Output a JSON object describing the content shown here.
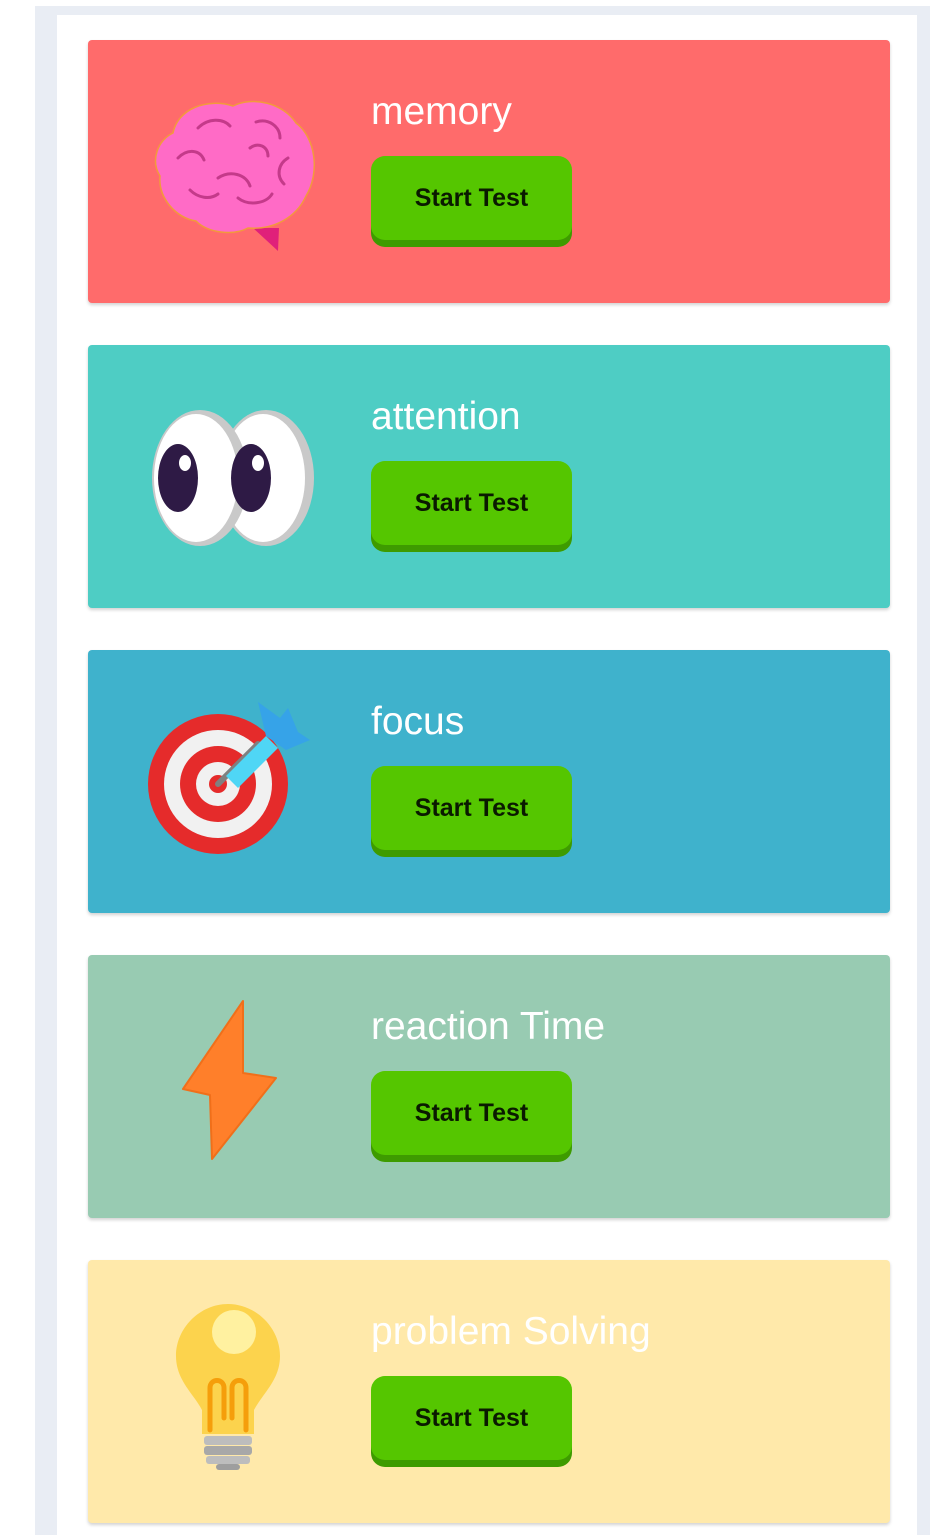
{
  "colors": {
    "memory_card": "#ff6b6b",
    "attention_card": "#4ecdc4",
    "focus_card": "#3fb2cc",
    "reaction_card": "#98cbb2",
    "problem_card": "#ffe9aa",
    "button": "#55c600",
    "button_shadow": "#3e9b00"
  },
  "tests": [
    {
      "title": "memory",
      "button_label": "Start Test",
      "icon": "brain-icon"
    },
    {
      "title": "attention",
      "button_label": "Start Test",
      "icon": "eyes-icon"
    },
    {
      "title": "focus",
      "button_label": "Start Test",
      "icon": "target-dart-icon"
    },
    {
      "title": "reaction Time",
      "button_label": "Start Test",
      "icon": "lightning-bolt-icon"
    },
    {
      "title": "problem Solving",
      "button_label": "Start Test",
      "icon": "light-bulb-icon"
    }
  ]
}
